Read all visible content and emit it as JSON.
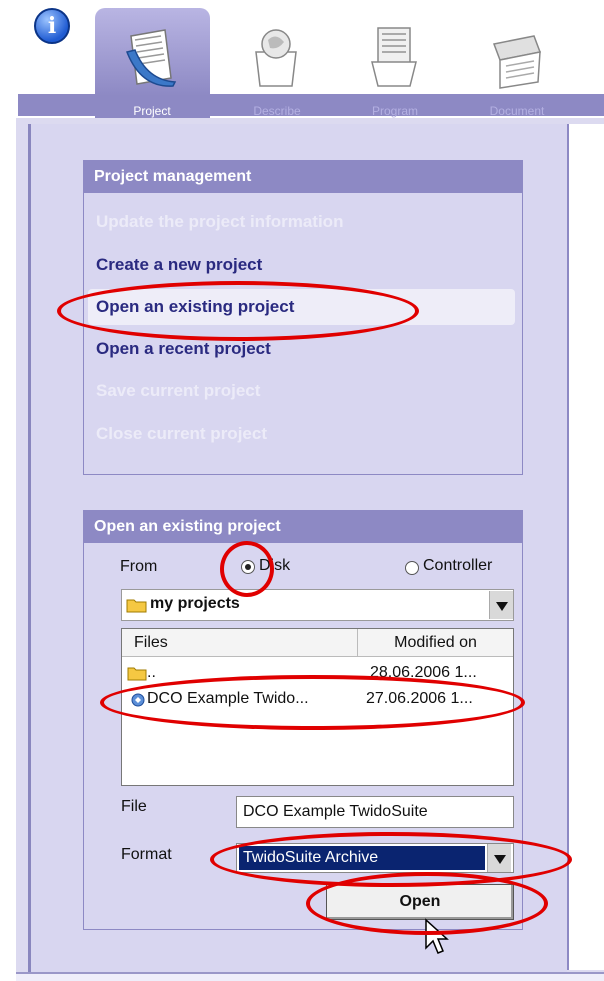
{
  "tabs": [
    {
      "label": "Project",
      "icon": "project-icon",
      "active": true
    },
    {
      "label": "Describe",
      "icon": "describe-icon",
      "active": false
    },
    {
      "label": "Program",
      "icon": "program-icon",
      "active": false
    },
    {
      "label": "Document",
      "icon": "document-icon",
      "active": false
    }
  ],
  "info_button": {
    "glyph": "i",
    "icon": "info-icon"
  },
  "project_management": {
    "title": "Project management",
    "items": [
      {
        "label": "Update the project information",
        "enabled": false
      },
      {
        "label": "Create a new project",
        "enabled": true
      },
      {
        "label": "Open an existing project",
        "enabled": true,
        "highlighted": true
      },
      {
        "label": "Open a recent project",
        "enabled": true
      },
      {
        "label": "Save current project",
        "enabled": false
      },
      {
        "label": "Close current project",
        "enabled": false
      }
    ]
  },
  "open_existing": {
    "title": "Open an existing project",
    "from_label": "From",
    "from_options": [
      {
        "label": "Disk",
        "selected": true
      },
      {
        "label": "Controller",
        "selected": false
      }
    ],
    "folder": "my projects",
    "columns": [
      "Files",
      "Modified on"
    ],
    "files": [
      {
        "name": "..",
        "modified": "28.06.2006 1...",
        "icon": "folder-icon"
      },
      {
        "name": "DCO Example Twido...",
        "modified": "27.06.2006 1...",
        "icon": "project-file-icon"
      }
    ],
    "file_label": "File",
    "file_value": "DCO Example TwidoSuite",
    "format_label": "Format",
    "format_value": "TwidoSuite Archive",
    "open_button": "Open"
  },
  "colors": {
    "accent": "#8d89c4",
    "panel": "#d8d6f0",
    "link": "#2a2a80",
    "annotation": "#e00000",
    "selection": "#0a2470"
  }
}
